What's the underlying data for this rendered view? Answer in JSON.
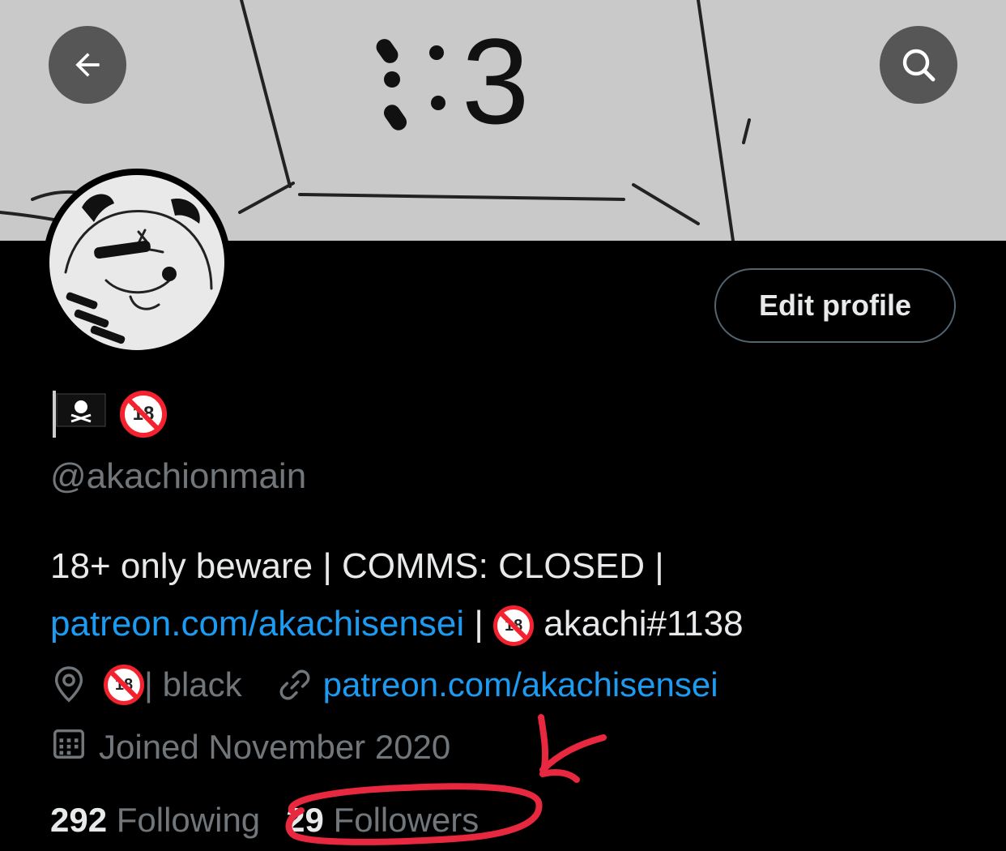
{
  "header": {
    "back_icon": "arrow-left-icon",
    "search_icon": "search-icon",
    "banner_text": ":3"
  },
  "profile": {
    "edit_label": "Edit profile",
    "emoji_flag": "🏴‍☠️",
    "emoji_18": "18",
    "handle": "@akachionmain",
    "bio_line1": "18+ only beware | COMMS: CLOSED |",
    "bio_link": "patreon.com/akachisensei",
    "bio_sep": " | ",
    "bio_tag": " akachi#1138",
    "location_text": " | black",
    "website": "patreon.com/akachisensei",
    "joined": "Joined November 2020"
  },
  "stats": {
    "following_count": "292",
    "following_label": "Following",
    "followers_count": "29",
    "followers_label": "Followers"
  },
  "colors": {
    "link": "#1d9bf0",
    "muted": "#71767b",
    "annotation": "#e8283f"
  }
}
